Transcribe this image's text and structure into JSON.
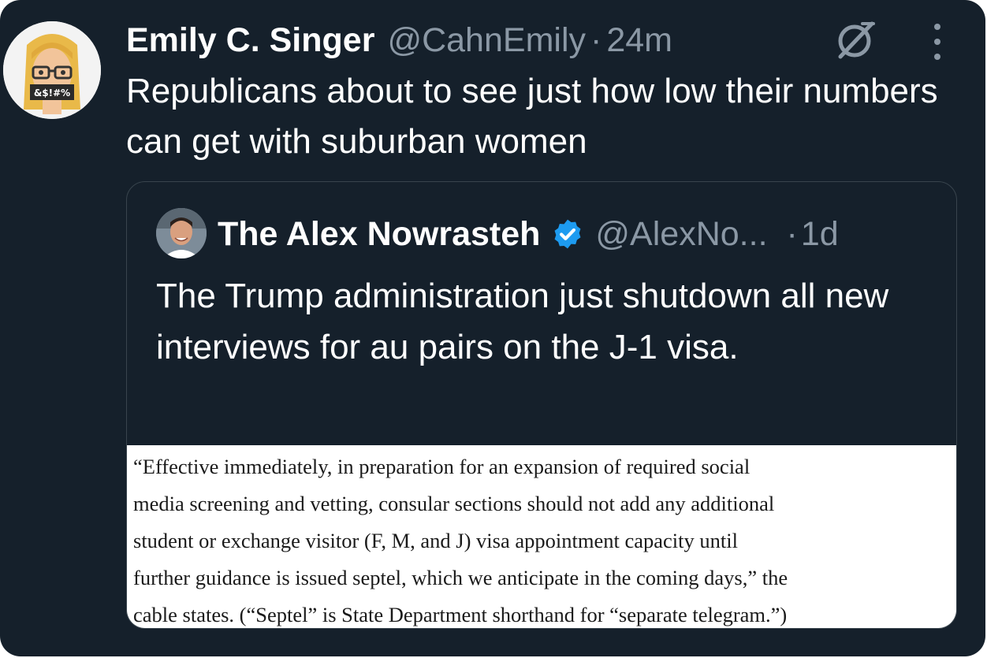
{
  "tweet": {
    "author_name": "Emily C. Singer",
    "author_handle": "@CahnEmily",
    "separator": "·",
    "time": "24m",
    "avatar_caption": "&$!#%",
    "text": "Republicans about to see just how low their numbers can get with suburban women",
    "icons": [
      "grok-icon",
      "more-icon"
    ]
  },
  "quote": {
    "author_name": "The Alex Nowrasteh",
    "author_handle": "@AlexNo...",
    "separator": "·",
    "time": "1d",
    "verified_color": "#1d9bf0",
    "text": "The Trump administration just shutdown all new interviews for au pairs on the J-1 visa.",
    "document_lines": [
      "“Effective immediately, in preparation for an expansion of required social",
      "media screening and vetting, consular sections should not add any additional",
      "student or exchange visitor (F, M, and J) visa appointment capacity until",
      "further guidance is issued septel, which we anticipate in the coming days,” the",
      "cable states. (“Septel” is State Department shorthand for “separate telegram.”)"
    ]
  },
  "colors": {
    "background": "#15202b",
    "primary_text": "#ffffff",
    "secondary_text": "#8b98a5",
    "border": "#38444d"
  }
}
